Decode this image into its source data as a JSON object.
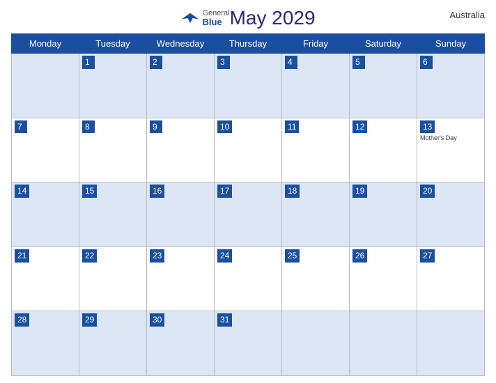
{
  "header": {
    "logo_general": "General",
    "logo_blue": "Blue",
    "title": "May 2029",
    "country": "Australia"
  },
  "days_of_week": [
    "Monday",
    "Tuesday",
    "Wednesday",
    "Thursday",
    "Friday",
    "Saturday",
    "Sunday"
  ],
  "weeks": [
    [
      {
        "num": "",
        "holiday": ""
      },
      {
        "num": "1",
        "holiday": ""
      },
      {
        "num": "2",
        "holiday": ""
      },
      {
        "num": "3",
        "holiday": ""
      },
      {
        "num": "4",
        "holiday": ""
      },
      {
        "num": "5",
        "holiday": ""
      },
      {
        "num": "6",
        "holiday": ""
      }
    ],
    [
      {
        "num": "7",
        "holiday": ""
      },
      {
        "num": "8",
        "holiday": ""
      },
      {
        "num": "9",
        "holiday": ""
      },
      {
        "num": "10",
        "holiday": ""
      },
      {
        "num": "11",
        "holiday": ""
      },
      {
        "num": "12",
        "holiday": ""
      },
      {
        "num": "13",
        "holiday": "Mother's Day"
      }
    ],
    [
      {
        "num": "14",
        "holiday": ""
      },
      {
        "num": "15",
        "holiday": ""
      },
      {
        "num": "16",
        "holiday": ""
      },
      {
        "num": "17",
        "holiday": ""
      },
      {
        "num": "18",
        "holiday": ""
      },
      {
        "num": "19",
        "holiday": ""
      },
      {
        "num": "20",
        "holiday": ""
      }
    ],
    [
      {
        "num": "21",
        "holiday": ""
      },
      {
        "num": "22",
        "holiday": ""
      },
      {
        "num": "23",
        "holiday": ""
      },
      {
        "num": "24",
        "holiday": ""
      },
      {
        "num": "25",
        "holiday": ""
      },
      {
        "num": "26",
        "holiday": ""
      },
      {
        "num": "27",
        "holiday": ""
      }
    ],
    [
      {
        "num": "28",
        "holiday": ""
      },
      {
        "num": "29",
        "holiday": ""
      },
      {
        "num": "30",
        "holiday": ""
      },
      {
        "num": "31",
        "holiday": ""
      },
      {
        "num": "",
        "holiday": ""
      },
      {
        "num": "",
        "holiday": ""
      },
      {
        "num": "",
        "holiday": ""
      }
    ]
  ]
}
